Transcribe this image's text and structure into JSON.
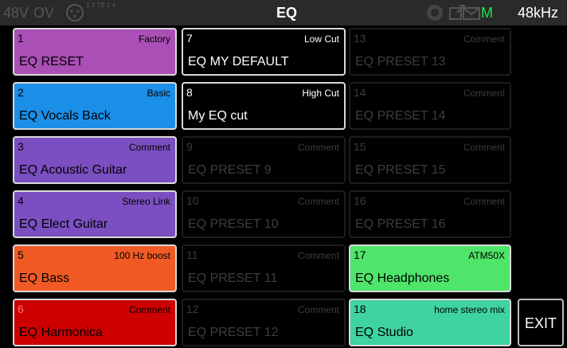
{
  "header": {
    "phantom": "48V",
    "overload": "OV",
    "indicator_small": "1 3 TB\n2 4",
    "title": "EQ",
    "mode": "M",
    "sample_rate": "48kHz",
    "icons": [
      "dial-icon",
      "export-icon",
      "mail-icon"
    ]
  },
  "presets": [
    {
      "num": "1",
      "tag": "Factory",
      "name": "EQ RESET",
      "color": "#a94fb5"
    },
    {
      "num": "2",
      "tag": "Basic",
      "name": "EQ Vocals Back",
      "color": "#1b8ee8"
    },
    {
      "num": "3",
      "tag": "Comment",
      "name": "EQ Acoustic Guitar",
      "color": "#7b4fc1"
    },
    {
      "num": "4",
      "tag": "Stereo Link",
      "name": "EQ Elect Guitar",
      "color": "#7b4fc1"
    },
    {
      "num": "5",
      "tag": "100 Hz boost",
      "name": "EQ Bass",
      "color": "#f15a24"
    },
    {
      "num": "6",
      "tag": "Comment",
      "name": "EQ Harmonica",
      "color": "#cc0000"
    },
    {
      "num": "7",
      "tag": "Low Cut",
      "name": "EQ MY DEFAULT",
      "color": "#000000"
    },
    {
      "num": "8",
      "tag": "High Cut",
      "name": "My EQ cut",
      "color": "#000000"
    },
    {
      "num": "9",
      "tag": "Comment",
      "name": "EQ PRESET 9",
      "color": ""
    },
    {
      "num": "10",
      "tag": "Comment",
      "name": "EQ PRESET 10",
      "color": ""
    },
    {
      "num": "11",
      "tag": "Comment",
      "name": "EQ PRESET 11",
      "color": ""
    },
    {
      "num": "12",
      "tag": "Comment",
      "name": "EQ PRESET 12",
      "color": ""
    },
    {
      "num": "13",
      "tag": "Comment",
      "name": "EQ PRESET 13",
      "color": ""
    },
    {
      "num": "14",
      "tag": "Comment",
      "name": "EQ PRESET 14",
      "color": ""
    },
    {
      "num": "15",
      "tag": "Comment",
      "name": "EQ PRESET 15",
      "color": ""
    },
    {
      "num": "16",
      "tag": "Comment",
      "name": "EQ PRESET 16",
      "color": ""
    },
    {
      "num": "17",
      "tag": "ATM50X",
      "name": "EQ Headphones",
      "color": "#4fe56a"
    },
    {
      "num": "18",
      "tag": "home stereo mix",
      "name": "EQ Studio",
      "color": "#3fd3a0"
    }
  ],
  "exit_label": "EXIT"
}
